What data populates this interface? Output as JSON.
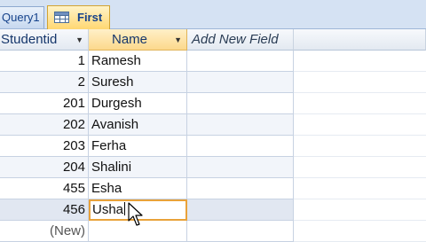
{
  "tabs": {
    "query_tab": "Query1",
    "active_tab": "First"
  },
  "columns": {
    "studentid": "Studentid",
    "name": "Name",
    "add_new_field": "Add New Field"
  },
  "rows": [
    {
      "id": "1",
      "name": "Ramesh"
    },
    {
      "id": "2",
      "name": "Suresh"
    },
    {
      "id": "201",
      "name": "Durgesh"
    },
    {
      "id": "202",
      "name": "Avanish"
    },
    {
      "id": "203",
      "name": "Ferha"
    },
    {
      "id": "204",
      "name": "Shalini"
    },
    {
      "id": "455",
      "name": "Esha"
    },
    {
      "id": "456",
      "name": "Usha"
    }
  ],
  "new_row_label": "(New)",
  "colors": {
    "tab_strip": "#d5e2f3",
    "active_tab": "#ffd772",
    "selected_cell_border": "#e9a23a",
    "header_text": "#15366b"
  }
}
